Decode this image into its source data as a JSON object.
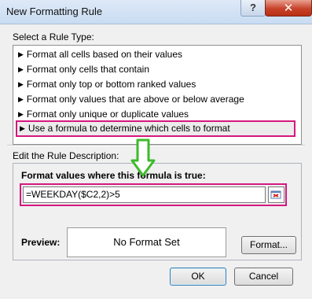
{
  "window": {
    "title": "New Formatting Rule",
    "help_glyph": "?",
    "close_glyph": "✕"
  },
  "rule_type": {
    "label": "Select a Rule Type:",
    "items": [
      {
        "label": "Format all cells based on their values"
      },
      {
        "label": "Format only cells that contain"
      },
      {
        "label": "Format only top or bottom ranked values"
      },
      {
        "label": "Format only values that are above or below average"
      },
      {
        "label": "Format only unique or duplicate values"
      },
      {
        "label": "Use a formula to determine which cells to format"
      }
    ],
    "selected_index": 5
  },
  "description": {
    "label": "Edit the Rule Description:",
    "formula_label": "Format values where this formula is true:",
    "formula_value": "=WEEKDAY($C2,2)>5",
    "preview_label": "Preview:",
    "preview_text": "No Format Set",
    "format_button": "Format..."
  },
  "buttons": {
    "ok": "OK",
    "cancel": "Cancel"
  },
  "colors": {
    "highlight": "#d6177f",
    "arrow": "#3dbb2a",
    "title_gradient_top": "#dde9f7"
  },
  "icons": {
    "arrow": "down-arrow-icon",
    "collapse": "collapse-dialog-icon",
    "bullet": "triangle-right-icon"
  }
}
